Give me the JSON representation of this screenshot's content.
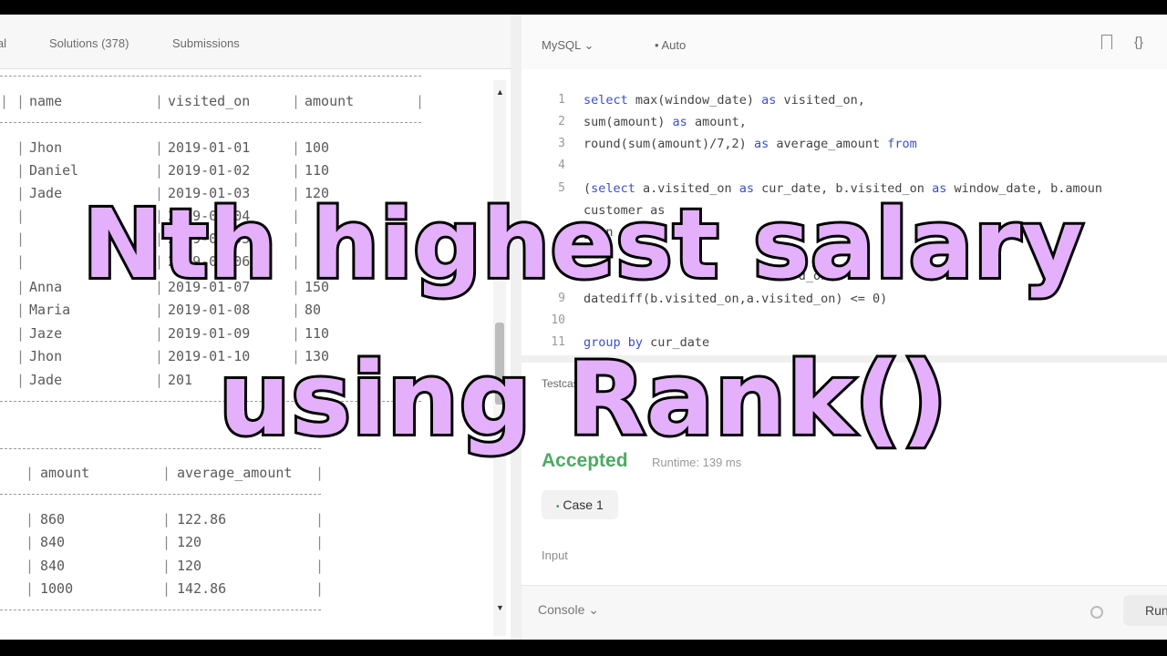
{
  "tabs": {
    "partial": "ial",
    "solutions": "Solutions (378)",
    "submissions": "Submissions"
  },
  "table1": {
    "headers": [
      "name",
      "visited_on",
      "amount"
    ],
    "rows": [
      [
        "Jhon",
        "2019-01-01",
        "100"
      ],
      [
        "Daniel",
        "2019-01-02",
        "110"
      ],
      [
        "Jade",
        "2019-01-03",
        "120"
      ],
      [
        "",
        "2019-01-04",
        ""
      ],
      [
        "",
        "2019-01-05",
        ""
      ],
      [
        "",
        "2019-01-06",
        ""
      ],
      [
        "Anna",
        "2019-01-07",
        "150"
      ],
      [
        "Maria",
        "2019-01-08",
        "80"
      ],
      [
        "Jaze",
        "2019-01-09",
        "110"
      ],
      [
        "Jhon",
        "2019-01-10",
        "130"
      ],
      [
        "Jade",
        "201",
        ""
      ]
    ]
  },
  "table2": {
    "headers": [
      "amount",
      "average_amount"
    ],
    "rows": [
      [
        "860",
        "122.86"
      ],
      [
        "840",
        "120"
      ],
      [
        "840",
        "120"
      ],
      [
        "1000",
        "142.86"
      ]
    ]
  },
  "editor": {
    "language": "MySQL",
    "mode": "Auto",
    "braces": "{}",
    "lines": [
      {
        "n": "1",
        "text": "select max(window_date) as visited_on,"
      },
      {
        "n": "2",
        "text": "sum(amount) as amount,"
      },
      {
        "n": "3",
        "text": "round(sum(amount)/7,2) as average_amount from"
      },
      {
        "n": "4",
        "text": ""
      },
      {
        "n": "5",
        "text": "(select a.visited_on as cur_date, b.visited_on as window_date, b.amoun"
      },
      {
        "n": "",
        "text": "customer as"
      },
      {
        "n": "",
        "text": "join"
      },
      {
        "n": "",
        "text": ""
      },
      {
        "n": "",
        "text": "                             d_on"
      },
      {
        "n": "9",
        "text": "datediff(b.visited_on,a.visited_on) <= 0)"
      },
      {
        "n": "10",
        "text": ""
      },
      {
        "n": "11",
        "text": "group by cur_date"
      }
    ]
  },
  "results": {
    "tab_label": "Testcase",
    "status": "Accepted",
    "runtime": "Runtime: 139 ms",
    "case_label": "Case 1",
    "input_label": "Input"
  },
  "bottom": {
    "console": "Console",
    "run": "Run"
  },
  "overlay": {
    "line1": "Nth highest salary",
    "line2": "using Rank()"
  },
  "colors": {
    "overlay_fill": "#e4b0fb",
    "accepted": "#2e9c4a",
    "keyword": "#3d4fc4"
  }
}
